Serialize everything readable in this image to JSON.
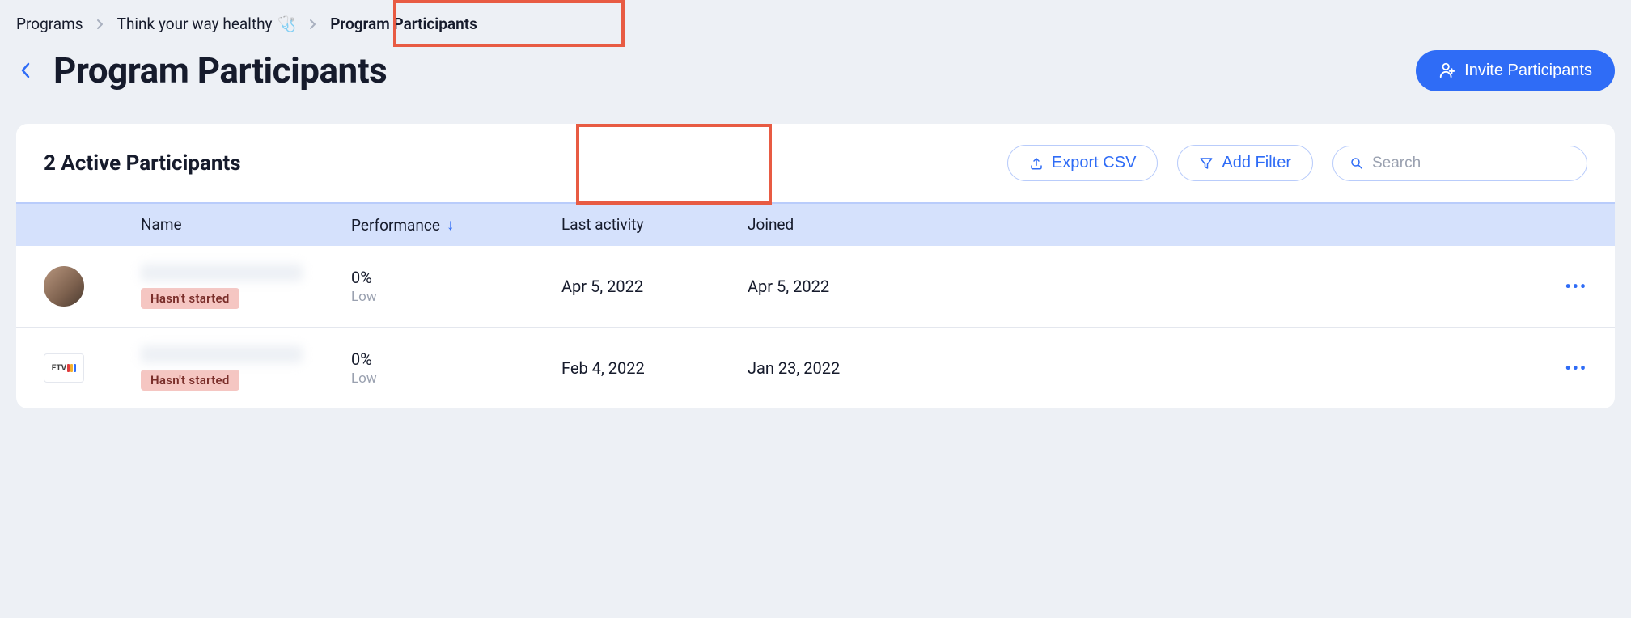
{
  "breadcrumb": {
    "items": [
      {
        "label": "Programs"
      },
      {
        "label": "Think your way healthy",
        "icon": "🩺"
      },
      {
        "label": "Program Participants"
      }
    ]
  },
  "header": {
    "title": "Program Participants",
    "invite_label": "Invite Participants"
  },
  "toolbar": {
    "count_title": "2 Active Participants",
    "export_label": "Export CSV",
    "filter_label": "Add Filter",
    "search_placeholder": "Search"
  },
  "table": {
    "columns": {
      "name": "Name",
      "performance": "Performance",
      "last_activity": "Last activity",
      "joined": "Joined"
    },
    "rows": [
      {
        "avatar_kind": "photo",
        "status": "Hasn't started",
        "performance_value": "0%",
        "performance_label": "Low",
        "last_activity": "Apr 5, 2022",
        "joined": "Apr 5, 2022"
      },
      {
        "avatar_kind": "logo",
        "avatar_text": "FTV",
        "status": "Hasn't started",
        "performance_value": "0%",
        "performance_label": "Low",
        "last_activity": "Feb 4, 2022",
        "joined": "Jan 23, 2022"
      }
    ]
  }
}
